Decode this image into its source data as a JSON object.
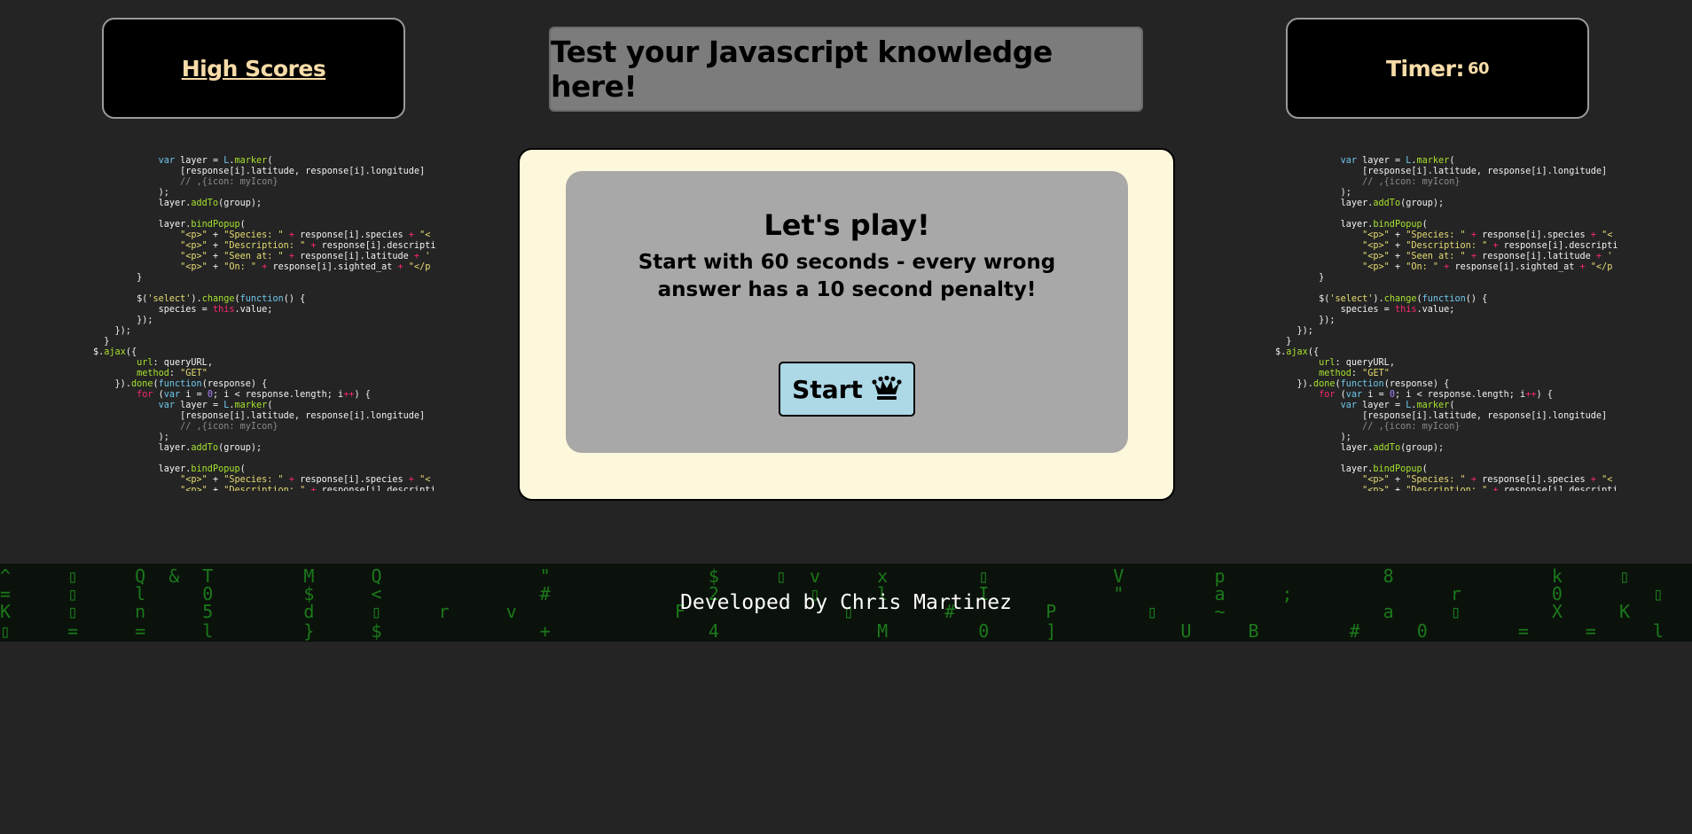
{
  "high_scores": {
    "label": "High Scores"
  },
  "timer": {
    "label": "Timer:",
    "value": "60"
  },
  "header": {
    "title": "Test your Javascript knowledge here!"
  },
  "quiz": {
    "title": "Let's play!",
    "description": "Start with 60 seconds - every wrong answer has a 10 second penalty!",
    "start_label": "Start",
    "start_icon": "chess-queen-icon"
  },
  "footer": {
    "text": "Developed by Chris Martinez"
  },
  "colors": {
    "background": "#242424",
    "accent_text": "#f7dca8",
    "card_background": "#fdf7dc",
    "inner_card": "#a8a8a8",
    "start_button": "#add8e6",
    "matrix_green": "#1e8a1e"
  }
}
